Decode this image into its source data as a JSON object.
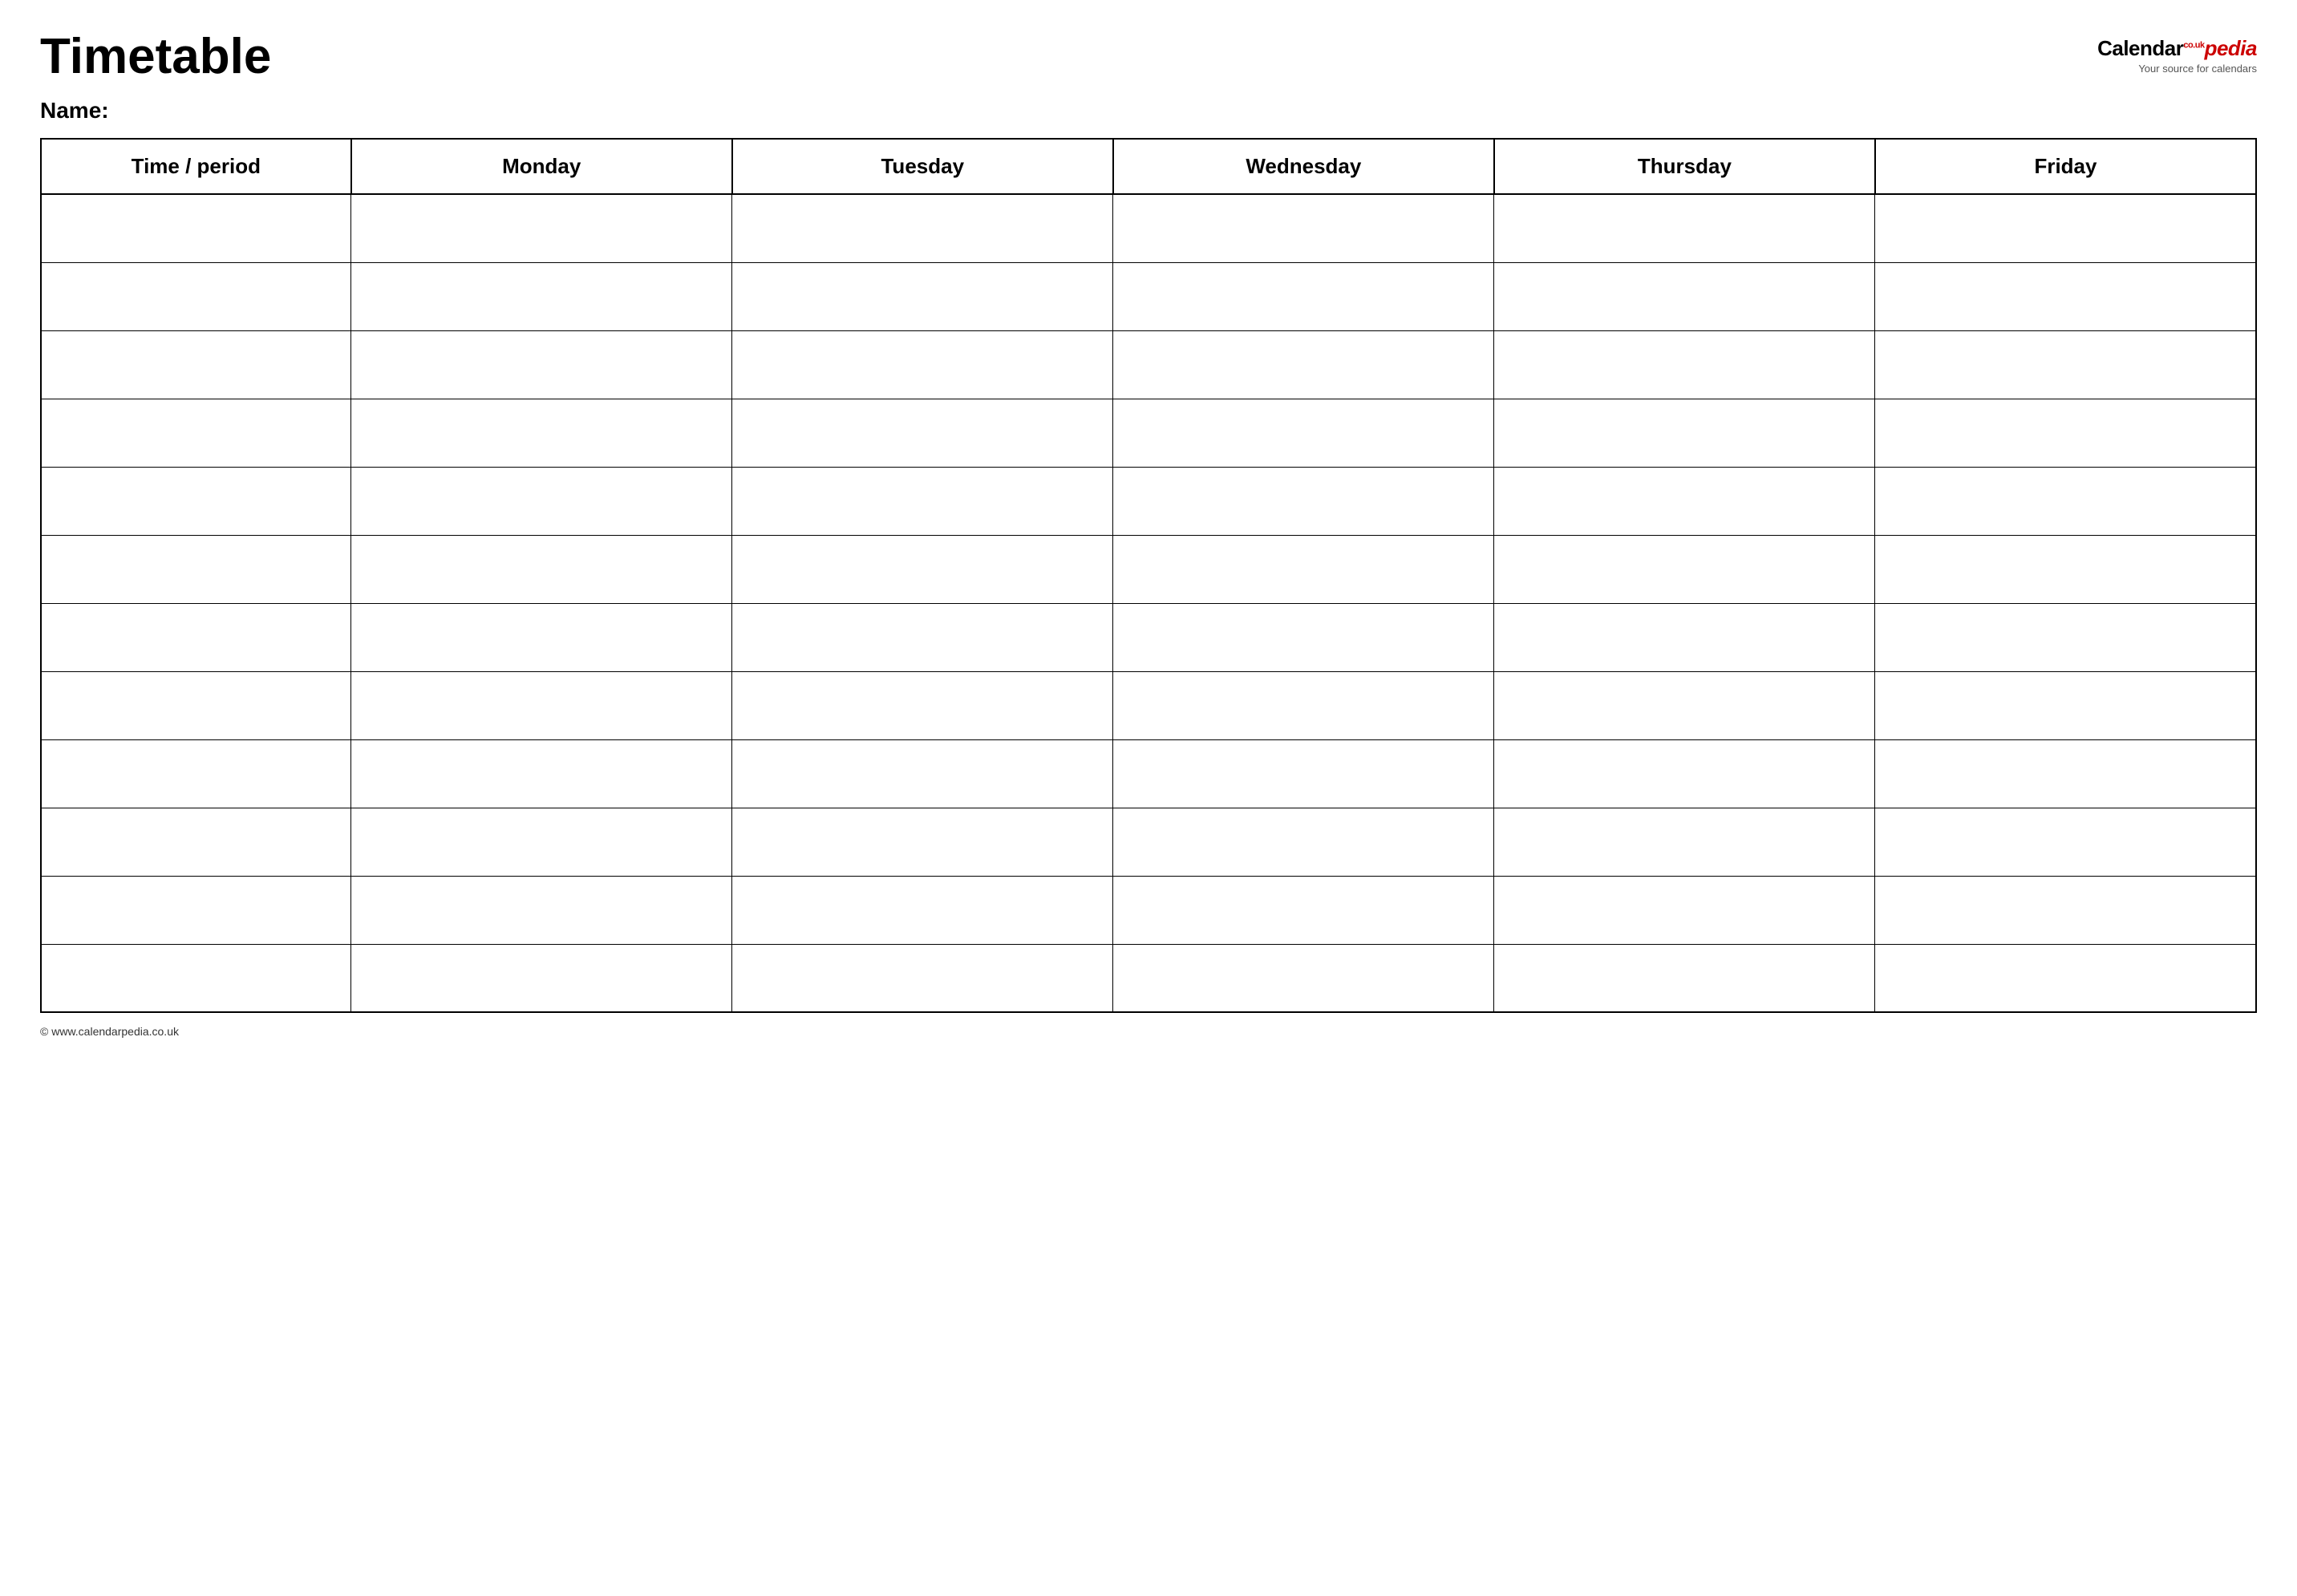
{
  "page": {
    "title": "Timetable",
    "name_label": "Name:",
    "logo": {
      "calendar_text": "Calendar",
      "pedia_text": "pedia",
      "co_uk": "co.uk",
      "subtitle": "Your source for calendars"
    },
    "footer_url": "www.calendarpedia.co.uk"
  },
  "table": {
    "headers": [
      "Time / period",
      "Monday",
      "Tuesday",
      "Wednesday",
      "Thursday",
      "Friday"
    ],
    "row_count": 12
  }
}
